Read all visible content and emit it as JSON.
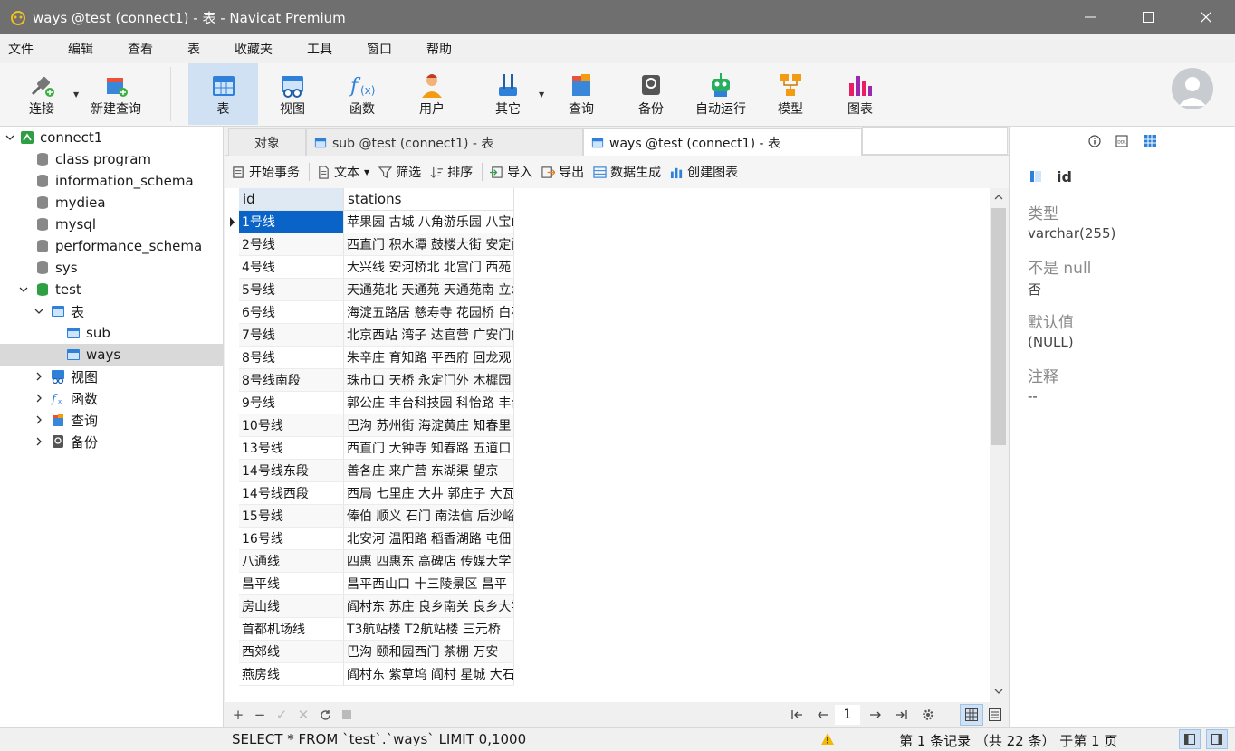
{
  "window": {
    "title": "ways @test (connect1) - 表 - Navicat Premium"
  },
  "menu": [
    "文件",
    "编辑",
    "查看",
    "表",
    "收藏夹",
    "工具",
    "窗口",
    "帮助"
  ],
  "toolbar": {
    "connect": "连接",
    "new_query": "新建查询",
    "table": "表",
    "view": "视图",
    "function": "函数",
    "user": "用户",
    "other": "其它",
    "query": "查询",
    "backup": "备份",
    "automation": "自动运行",
    "model": "模型",
    "chart": "图表"
  },
  "sidebar": {
    "connection": "connect1",
    "databases": [
      "class program",
      "information_schema",
      "mydiea",
      "mysql",
      "performance_schema",
      "sys"
    ],
    "test_db": "test",
    "tables_group": "表",
    "tables": [
      "sub",
      "ways"
    ],
    "views": "视图",
    "functions": "函数",
    "queries": "查询",
    "backups": "备份"
  },
  "tabs": {
    "objects": "对象",
    "sub_tab": "sub @test (connect1) - 表",
    "ways_tab": "ways @test (connect1) - 表"
  },
  "table_toolbar": {
    "begin_transaction": "开始事务",
    "text": "文本",
    "filter": "筛选",
    "sort": "排序",
    "import": "导入",
    "export": "导出",
    "data_generation": "数据生成",
    "create_chart": "创建图表"
  },
  "grid": {
    "columns": [
      "id",
      "stations"
    ],
    "rows": [
      [
        "1号线",
        "苹果园 古城 八角游乐园 八宝山"
      ],
      [
        "2号线",
        "西直门 积水潭 鼓楼大街 安定门"
      ],
      [
        "4号线",
        "大兴线 安河桥北 北宫门 西苑"
      ],
      [
        "5号线",
        "天通苑北 天通苑 天通苑南 立水桥"
      ],
      [
        "6号线",
        "海淀五路居 慈寿寺 花园桥 白石桥"
      ],
      [
        "7号线",
        "北京西站 湾子 达官营 广安门内"
      ],
      [
        "8号线",
        "朱辛庄 育知路 平西府 回龙观"
      ],
      [
        "8号线南段",
        "珠市口 天桥 永定门外 木樨园"
      ],
      [
        "9号线",
        "郭公庄 丰台科技园 科怡路 丰台南路"
      ],
      [
        "10号线",
        "巴沟 苏州街 海淀黄庄 知春里"
      ],
      [
        "13号线",
        "西直门 大钟寺 知春路 五道口"
      ],
      [
        "14号线东段",
        "善各庄 来广营 东湖渠 望京"
      ],
      [
        "14号线西段",
        "西局 七里庄 大井 郭庄子 大瓦窑"
      ],
      [
        "15号线",
        "俸伯 顺义 石门 南法信 后沙峪"
      ],
      [
        "16号线",
        "北安河 温阳路 稻香湖路 屯佃"
      ],
      [
        "八通线",
        "四惠 四惠东 高碑店 传媒大学"
      ],
      [
        "昌平线",
        "昌平西山口 十三陵景区 昌平"
      ],
      [
        "房山线",
        "阎村东 苏庄 良乡南关 良乡大学城"
      ],
      [
        "首都机场线",
        "T3航站楼 T2航站楼 三元桥"
      ],
      [
        "西郊线",
        "巴沟 颐和园西门 茶棚 万安"
      ],
      [
        "燕房线",
        "阎村东 紫草坞 阎村 星城 大石河东"
      ]
    ]
  },
  "pager": {
    "page": "1"
  },
  "right_panel": {
    "field": "id",
    "type_label": "类型",
    "type_value": "varchar(255)",
    "notnull_label": "不是 null",
    "notnull_value": "否",
    "default_label": "默认值",
    "default_value": "(NULL)",
    "comment_label": "注释",
    "comment_value": "--"
  },
  "status": {
    "sql": "SELECT * FROM `test`.`ways` LIMIT 0,1000",
    "records": "第 1 条记录 （共 22 条） 于第 1 页"
  },
  "colors": {
    "selection": "#0a64c8",
    "titlebar": "#6f6f6f",
    "active_tool": "#cfe1f3"
  }
}
